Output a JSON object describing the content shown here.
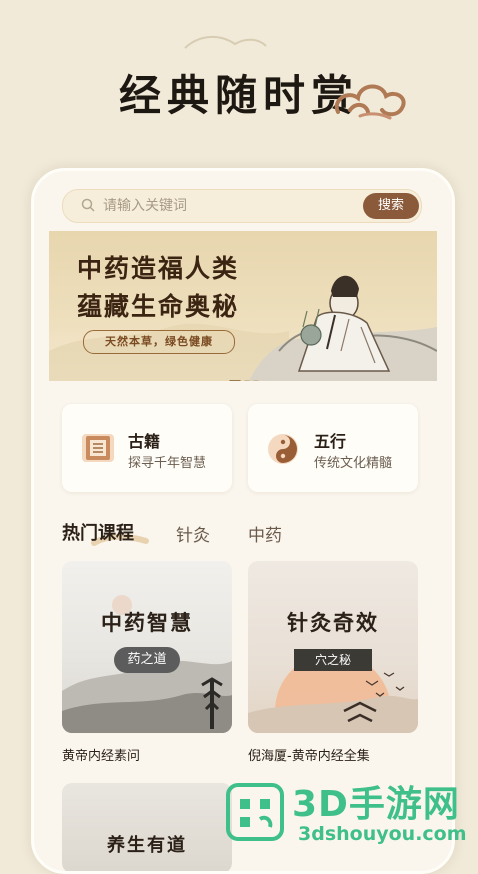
{
  "hero": {
    "title": "经典随时赏"
  },
  "search": {
    "placeholder": "请输入关键词",
    "button_label": "搜索"
  },
  "banner": {
    "line1": "中药造福人类",
    "line2": "蕴藏生命奥秘",
    "tag": "天然本草，绿色健康"
  },
  "entries": [
    {
      "title": "古籍",
      "subtitle": "探寻千年智慧",
      "icon": "book-icon"
    },
    {
      "title": "五行",
      "subtitle": "传统文化精髓",
      "icon": "yin-yang-icon"
    }
  ],
  "tabs": [
    {
      "label": "热门课程",
      "active": true
    },
    {
      "label": "针灸",
      "active": false
    },
    {
      "label": "中药",
      "active": false
    }
  ],
  "courses": [
    {
      "title": "中药智慧",
      "badge": "药之道",
      "caption": "黄帝内经素问"
    },
    {
      "title": "针灸奇效",
      "badge": "穴之秘",
      "caption": "倪海厦-黄帝内经全集"
    },
    {
      "title": "养生有道",
      "badge": "",
      "caption": ""
    }
  ],
  "watermark": {
    "brand": "3D手游网",
    "url": "3dshouyou.com"
  },
  "colors": {
    "accent": "#8a5a3a",
    "background": "#f1ead9",
    "watermark_green": "#3fbf8a"
  }
}
